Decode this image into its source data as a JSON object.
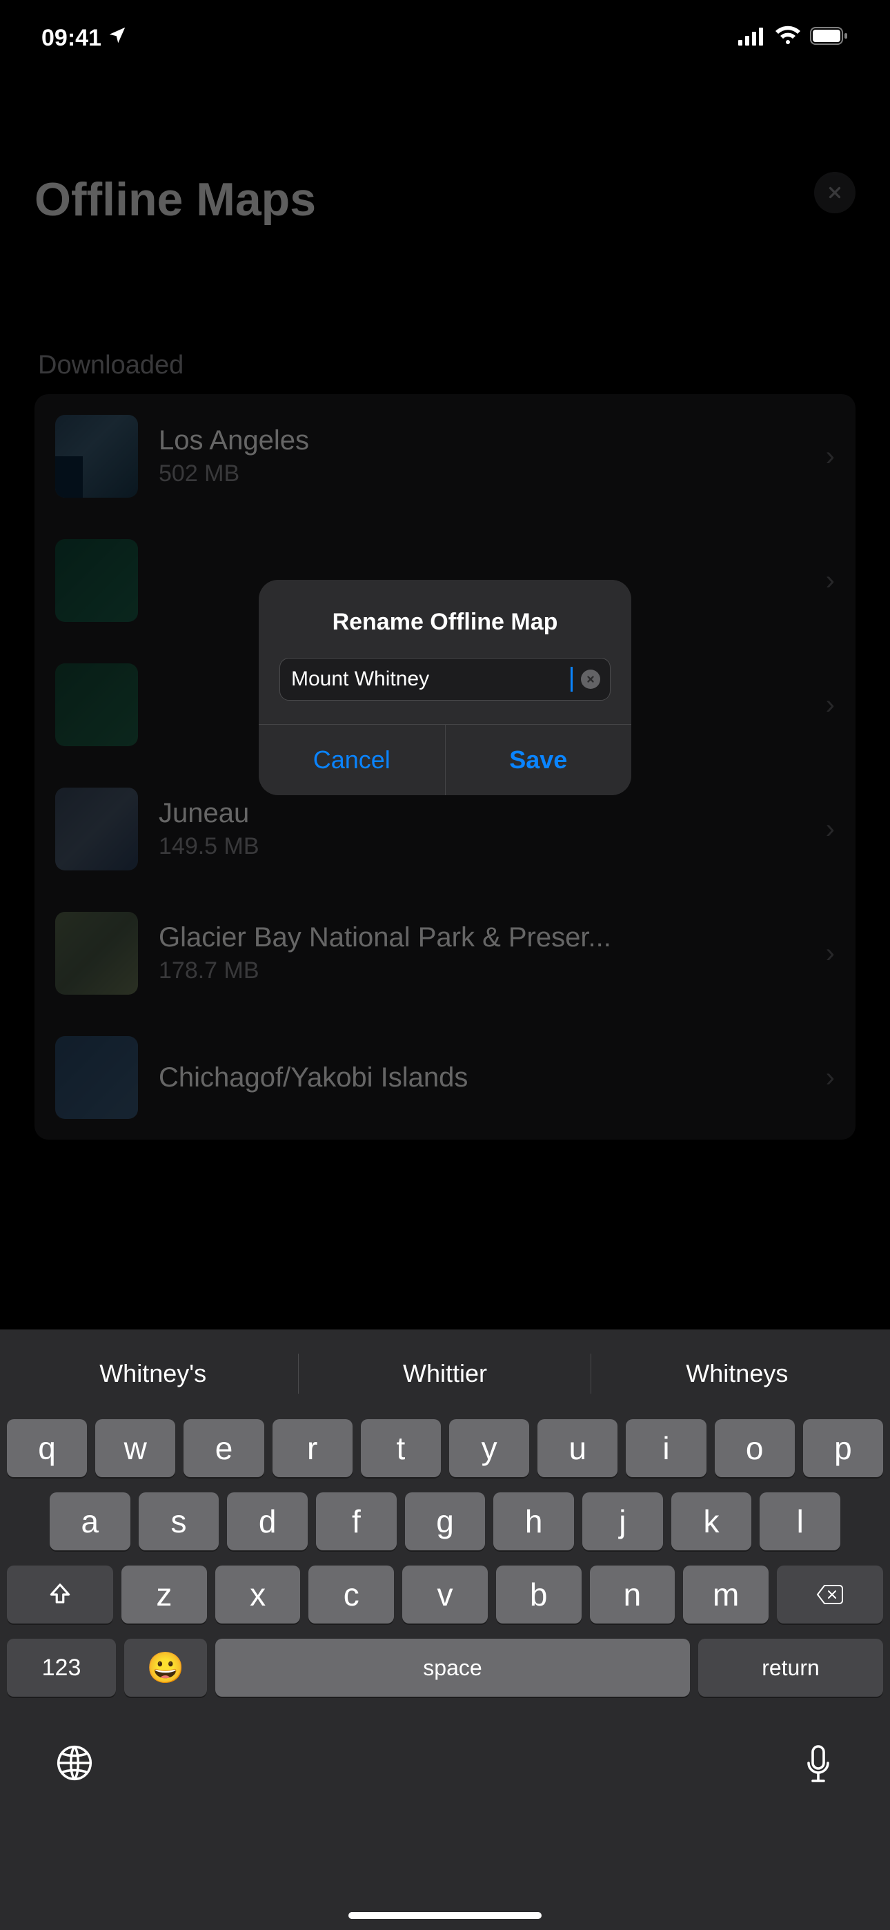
{
  "status": {
    "time": "09:41"
  },
  "header": {
    "title": "Offline Maps"
  },
  "section": {
    "downloaded": "Downloaded"
  },
  "maps": [
    {
      "title": "Los Angeles",
      "size": "502 MB"
    },
    {
      "title": "",
      "size": ""
    },
    {
      "title": "",
      "size": ""
    },
    {
      "title": "Juneau",
      "size": "149.5 MB"
    },
    {
      "title": "Glacier Bay National Park & Preser...",
      "size": "178.7 MB"
    },
    {
      "title": "Chichagof/Yakobi Islands",
      "size": ""
    }
  ],
  "alert": {
    "title": "Rename Offline Map",
    "value": "Mount Whitney",
    "cancel": "Cancel",
    "save": "Save"
  },
  "suggestions": [
    "Whitney's",
    "Whittier",
    "Whitneys"
  ],
  "keys": {
    "r1": [
      "q",
      "w",
      "e",
      "r",
      "t",
      "y",
      "u",
      "i",
      "o",
      "p"
    ],
    "r2": [
      "a",
      "s",
      "d",
      "f",
      "g",
      "h",
      "j",
      "k",
      "l"
    ],
    "r3": [
      "z",
      "x",
      "c",
      "v",
      "b",
      "n",
      "m"
    ],
    "numbers": "123",
    "space": "space",
    "return": "return"
  }
}
